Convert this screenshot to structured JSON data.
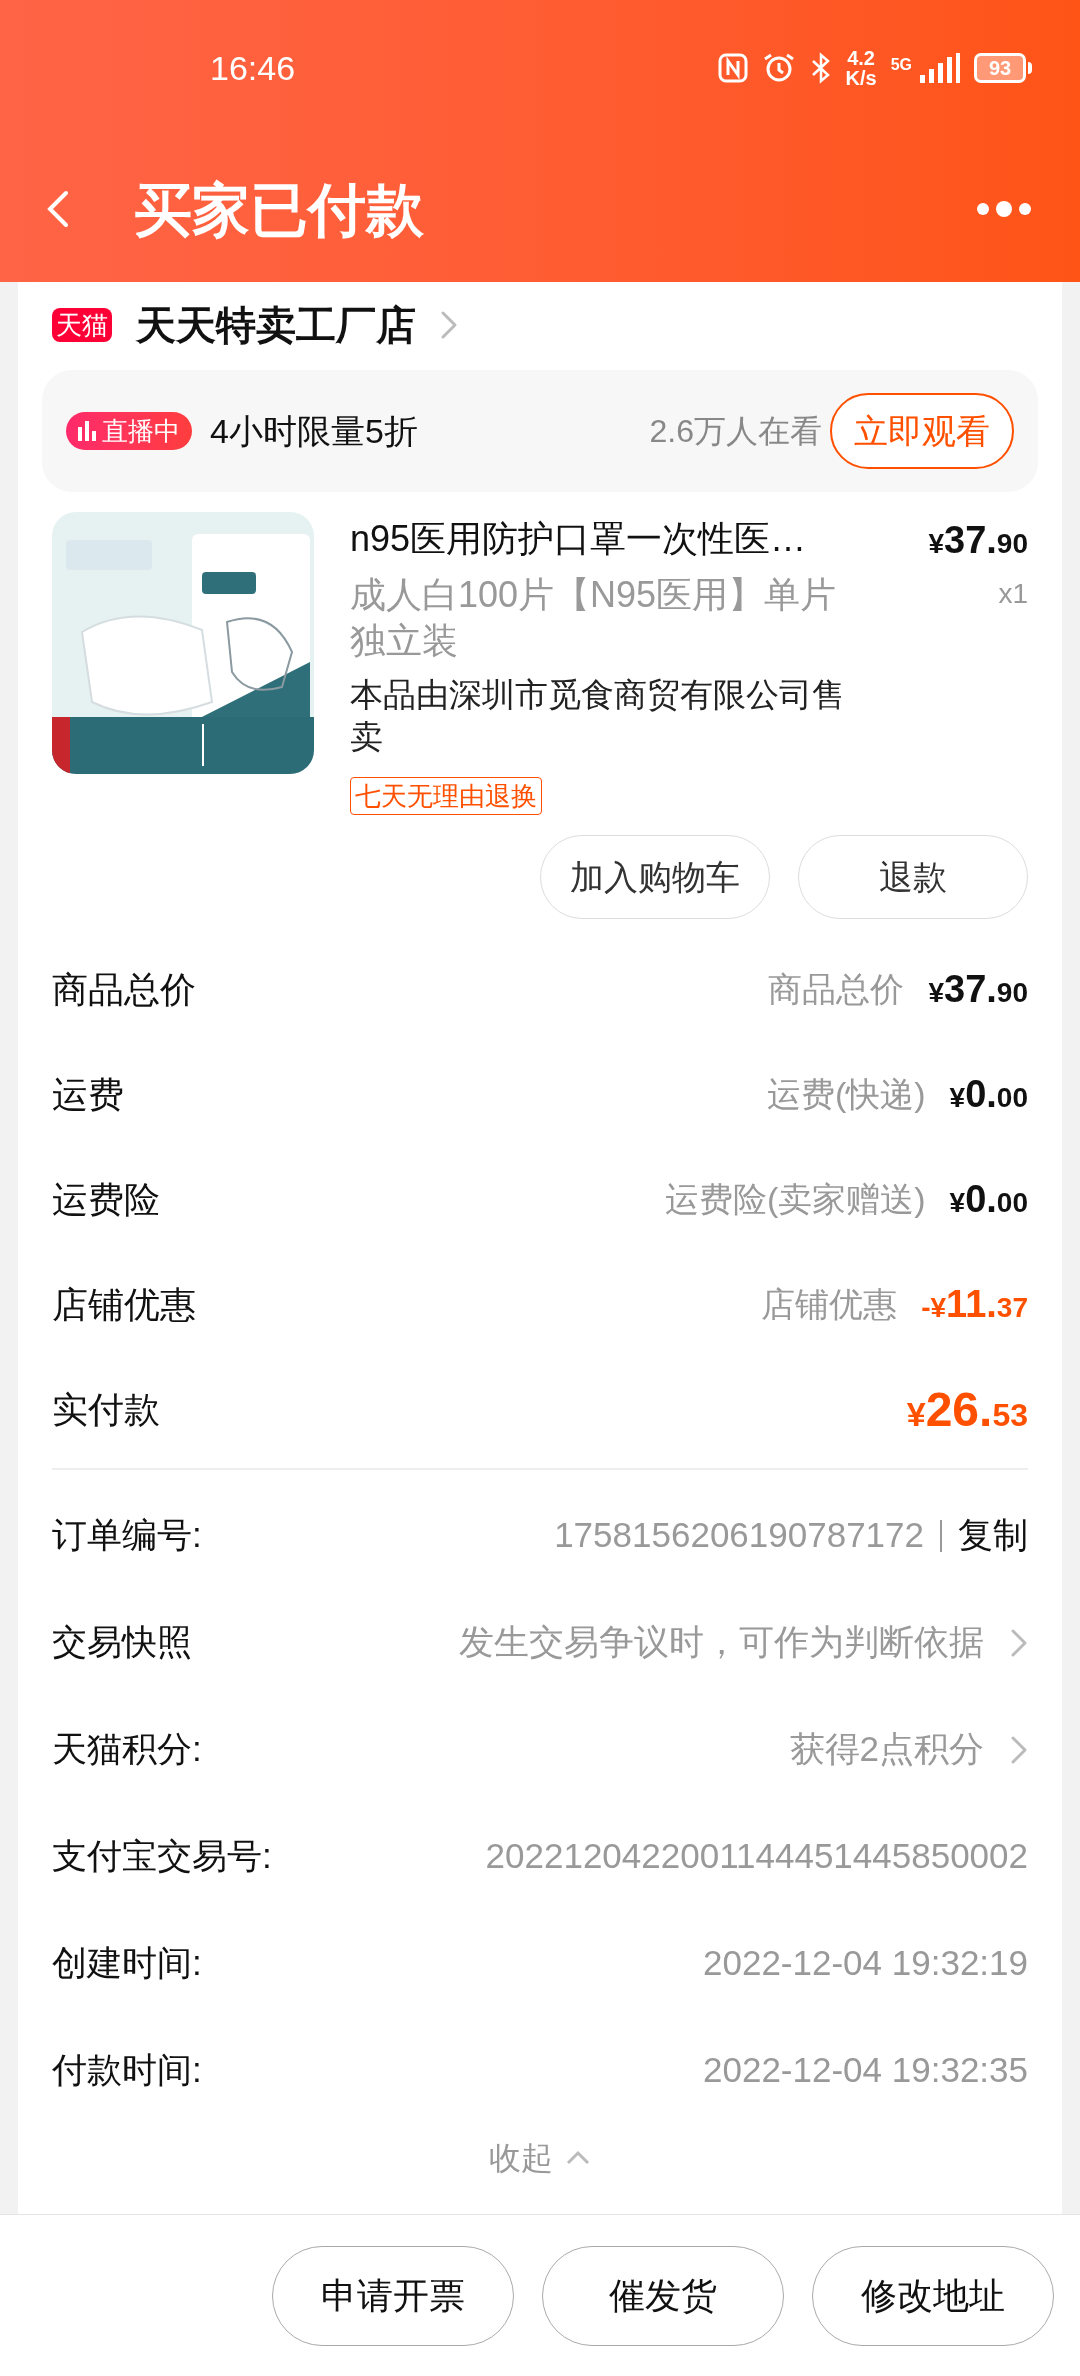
{
  "status_bar": {
    "time": "16:46",
    "speed_value": "4.2",
    "speed_unit": "K/s",
    "network": "5G",
    "battery": "93"
  },
  "header": {
    "title": "买家已付款"
  },
  "shop": {
    "badge": "天猫",
    "name": "天天特卖工厂店"
  },
  "live_banner": {
    "badge": "直播中",
    "promo": "4小时限量5折",
    "viewers": "2.6万人在看",
    "button": "立即观看"
  },
  "product": {
    "title": "n95医用防护口罩一次性医…",
    "spec": "成人白100片【N95医用】单片独立装",
    "seller": "本品由深圳市觅食商贸有限公司售卖",
    "tag": "七天无理由退换",
    "price": "¥37.90",
    "quantity": "x1",
    "buttons": [
      "加入购物车",
      "退款"
    ]
  },
  "amounts": [
    {
      "kind": "normal",
      "label": "商品总价",
      "detail": "商品总价",
      "amount": "¥37.90"
    },
    {
      "kind": "normal",
      "label": "运费",
      "detail": "运费(快递)",
      "amount": "¥0.00"
    },
    {
      "kind": "normal",
      "label": "运费险",
      "detail": "运费险(卖家赠送)",
      "amount": "¥0.00"
    },
    {
      "kind": "discount",
      "label": "店铺优惠",
      "detail": "店铺优惠",
      "amount": "-¥11.37"
    },
    {
      "kind": "total",
      "label": "实付款",
      "amount": "¥26.53"
    }
  ],
  "order_info": [
    {
      "label": "订单编号:",
      "value": "1758156206190787172",
      "action": "复制",
      "chevron": false
    },
    {
      "label": "交易快照",
      "value": "发生交易争议时，可作为判断依据",
      "chevron": true
    },
    {
      "label": "天猫积分:",
      "value": "获得2点积分",
      "chevron": true
    },
    {
      "label": "支付宝交易号:",
      "value": "2022120422001144451445850002",
      "chevron": false
    },
    {
      "label": "创建时间:",
      "value": "2022-12-04 19:32:19",
      "chevron": false
    },
    {
      "label": "付款时间:",
      "value": "2022-12-04 19:32:35",
      "chevron": false
    }
  ],
  "collapse": {
    "label": "收起"
  },
  "bottom_buttons": [
    "申请开票",
    "催发货",
    "修改地址"
  ]
}
